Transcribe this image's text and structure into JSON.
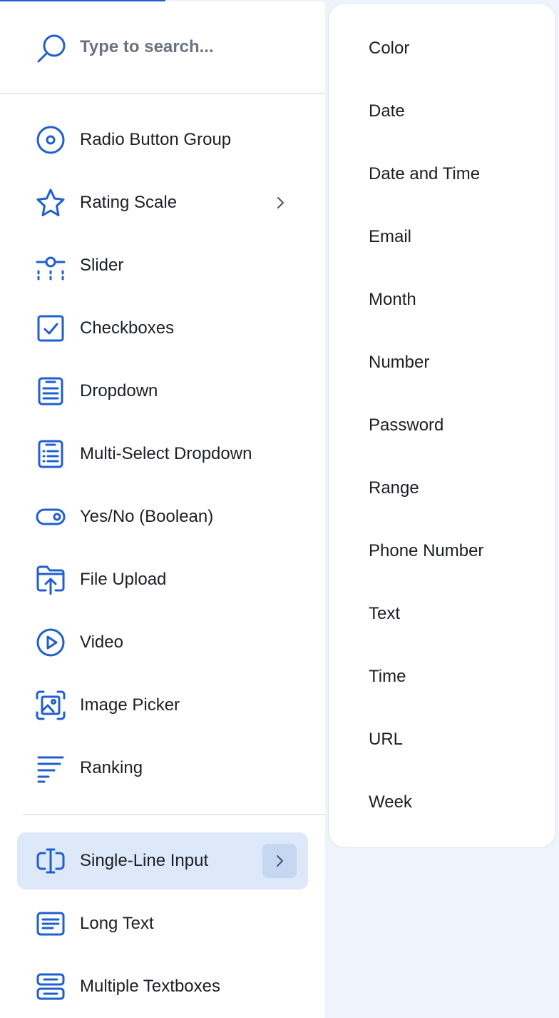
{
  "search": {
    "placeholder": "Type to search..."
  },
  "menu": {
    "items": [
      {
        "label": "Radio Button Group",
        "icon": "radio-button-icon"
      },
      {
        "label": "Rating Scale",
        "icon": "star-icon",
        "has_submenu": true
      },
      {
        "label": "Slider",
        "icon": "slider-icon"
      },
      {
        "label": "Checkboxes",
        "icon": "checkbox-icon"
      },
      {
        "label": "Dropdown",
        "icon": "dropdown-icon"
      },
      {
        "label": "Multi-Select Dropdown",
        "icon": "multi-select-dropdown-icon"
      },
      {
        "label": "Yes/No (Boolean)",
        "icon": "toggle-icon"
      },
      {
        "label": "File Upload",
        "icon": "file-upload-icon"
      },
      {
        "label": "Video",
        "icon": "video-icon"
      },
      {
        "label": "Image Picker",
        "icon": "image-picker-icon"
      },
      {
        "label": "Ranking",
        "icon": "ranking-icon"
      }
    ],
    "items_after_divider": [
      {
        "label": "Single-Line Input",
        "icon": "text-cursor-icon",
        "selected": true,
        "has_submenu": true
      },
      {
        "label": "Long Text",
        "icon": "long-text-icon"
      },
      {
        "label": "Multiple Textboxes",
        "icon": "multiple-textboxes-icon"
      }
    ]
  },
  "submenu": {
    "items": [
      "Color",
      "Date",
      "Date and Time",
      "Email",
      "Month",
      "Number",
      "Password",
      "Range",
      "Phone Number",
      "Text",
      "Time",
      "URL",
      "Week"
    ]
  },
  "colors": {
    "accent": "#1f5fcf",
    "selected_bg": "#dde8f8",
    "panel_bg": "#eef3fc"
  }
}
